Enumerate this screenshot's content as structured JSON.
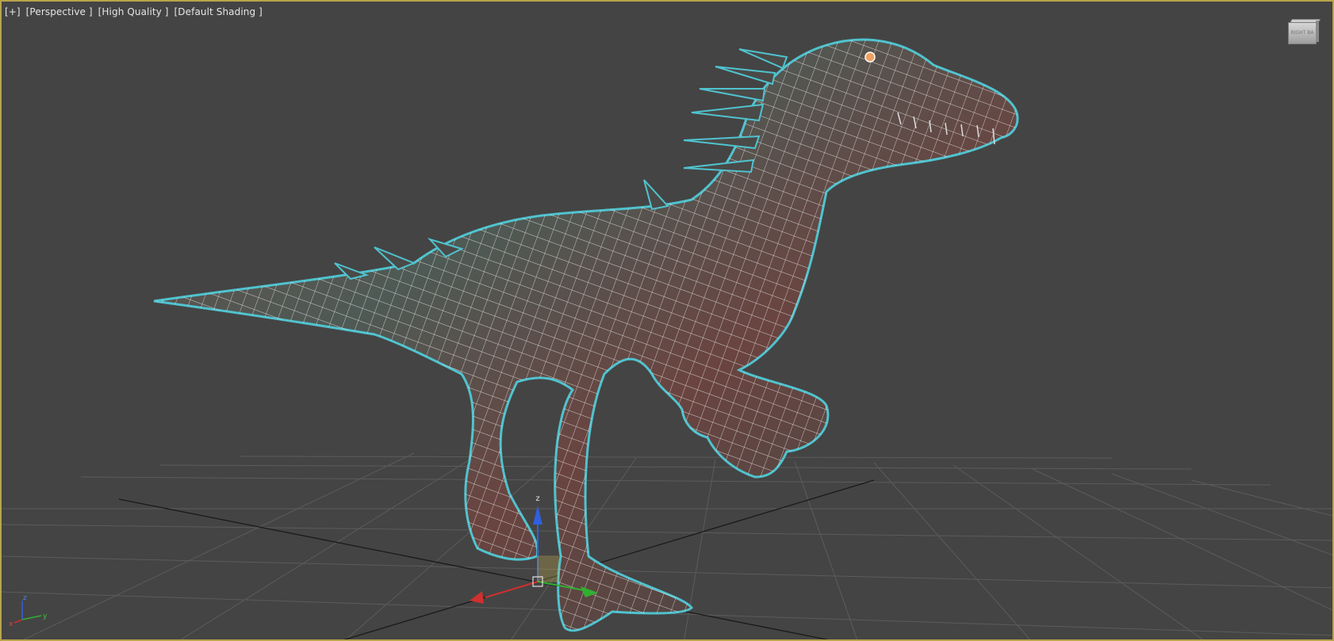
{
  "viewport": {
    "labels": [
      "[+]",
      "[Perspective ]",
      "[High Quality ]",
      "[Default Shading ]"
    ],
    "active_border_color": "#b8a44a",
    "background_color": "#444444",
    "selection_outline_color": "#4fc3cf"
  },
  "viewcube": {
    "face_labels": [
      "RIGHT",
      "BA"
    ]
  },
  "world_axis": {
    "labels": [
      "z",
      "y",
      "x"
    ],
    "colors": {
      "x": "#d03030",
      "y": "#30b030",
      "z": "#3060e0"
    }
  },
  "gizmo": {
    "axis_labels": [
      "z"
    ]
  },
  "model": {
    "name_icon": "raptor-mesh"
  }
}
